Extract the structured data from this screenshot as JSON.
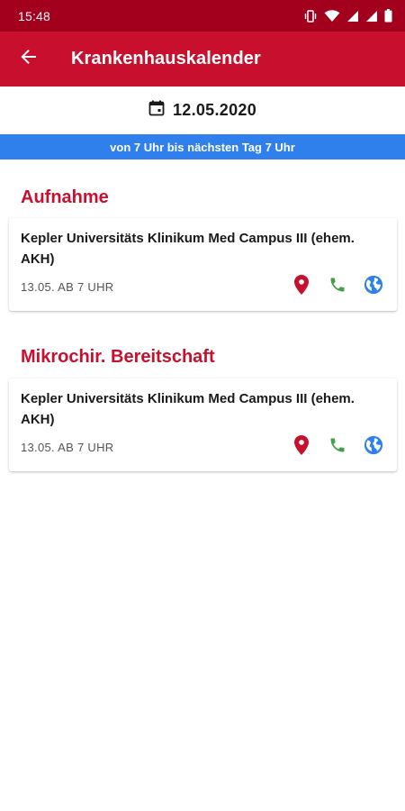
{
  "status_bar": {
    "time": "15:48",
    "icons": [
      "vibrate-icon",
      "wifi-icon",
      "signal-icon",
      "signal-icon",
      "battery-icon"
    ]
  },
  "app_bar": {
    "back_icon": "arrow-left-icon",
    "title": "Krankenhauskalender"
  },
  "date": {
    "icon": "calendar-icon",
    "value": "12.05.2020"
  },
  "banner": {
    "text": "von 7 Uhr bis nächsten Tag 7 Uhr"
  },
  "sections": [
    {
      "title": "Aufnahme",
      "card": {
        "name": "Kepler Universitäts Klinikum Med Campus III (ehem. AKH)",
        "time": "13.05. AB 7 UHR"
      }
    },
    {
      "title": "Mikrochir. Bereitschaft",
      "card": {
        "name": "Kepler Universitäts Klinikum Med Campus III (ehem. AKH)",
        "time": "13.05. AB 7 UHR"
      }
    }
  ],
  "actions": {
    "location_icon": "location-pin-icon",
    "phone_icon": "phone-icon",
    "web_icon": "globe-icon"
  },
  "colors": {
    "status_bar": "#a3001e",
    "app_bar": "#c8102e",
    "banner": "#2f80ed",
    "section_title": "#c8102e",
    "location": "#c8102e",
    "phone": "#43a047",
    "web": "#2f80ed"
  }
}
